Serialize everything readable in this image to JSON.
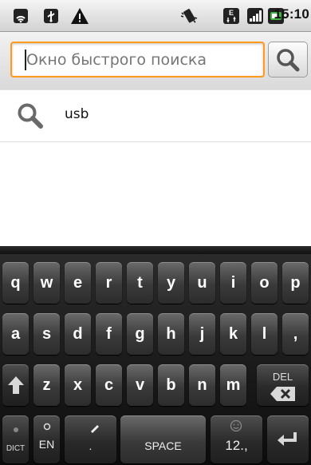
{
  "status_bar": {
    "time": "15:10",
    "icons": [
      "wireless-icon",
      "usb-icon",
      "warning-icon",
      "vibrate-icon",
      "network-type-icon",
      "signal-icon",
      "battery-icon"
    ]
  },
  "search": {
    "placeholder": "Окно быстрого поиска",
    "value": "",
    "button_icon": "search-icon",
    "border_color": "#ff9a1f"
  },
  "suggestions": [
    {
      "icon": "search-icon",
      "text": "usb"
    }
  ],
  "keyboard": {
    "row1": [
      "q",
      "w",
      "e",
      "r",
      "t",
      "y",
      "u",
      "i",
      "o",
      "p"
    ],
    "row2": [
      "a",
      "s",
      "d",
      "f",
      "g",
      "h",
      "j",
      "k",
      "l",
      ","
    ],
    "row3": [
      "z",
      "x",
      "c",
      "v",
      "b",
      "n",
      "m"
    ],
    "shift_icon": "shift-arrow-icon",
    "delete_label": "DEL",
    "delete_icon": "backspace-icon",
    "dict_label": "DICT",
    "lang_label": "EN",
    "voice_label": ".",
    "space_label": "SPACE",
    "symbols_label": "12.,",
    "enter_icon": "enter-icon"
  }
}
